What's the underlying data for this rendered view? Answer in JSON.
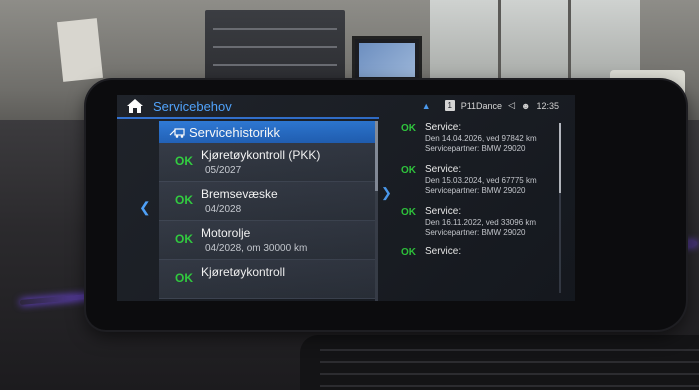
{
  "header": {
    "title": "Servicebehov",
    "profile": "P11Dance",
    "phone_badge": "1",
    "time": "12:35"
  },
  "history_header": "Servicehistorikk",
  "items": [
    {
      "status": "OK",
      "title": "Kjøretøykontroll (PKK)",
      "sub": "05/2027"
    },
    {
      "status": "OK",
      "title": "Bremsevæske",
      "sub": "04/2028"
    },
    {
      "status": "OK",
      "title": "Motorolje",
      "sub": "04/2028, om 30000 km"
    },
    {
      "status": "OK",
      "title": "Kjøretøykontroll",
      "sub": ""
    }
  ],
  "services": [
    {
      "status": "OK",
      "title": "Service:",
      "date": "Den 14.04.2026, ved 97842 km",
      "partner": "Servicepartner: BMW 29020"
    },
    {
      "status": "OK",
      "title": "Service:",
      "date": "Den 15.03.2024, ved 67775 km",
      "partner": "Servicepartner: BMW 29020"
    },
    {
      "status": "OK",
      "title": "Service:",
      "date": "Den 16.11.2022, ved 33096 km",
      "partner": "Servicepartner: BMW 29020"
    },
    {
      "status": "OK",
      "title": "Service:",
      "date": "",
      "partner": ""
    }
  ],
  "colors": {
    "accent": "#4da3ff",
    "ok": "#2fd33e",
    "ambient": "#7b4dff"
  }
}
